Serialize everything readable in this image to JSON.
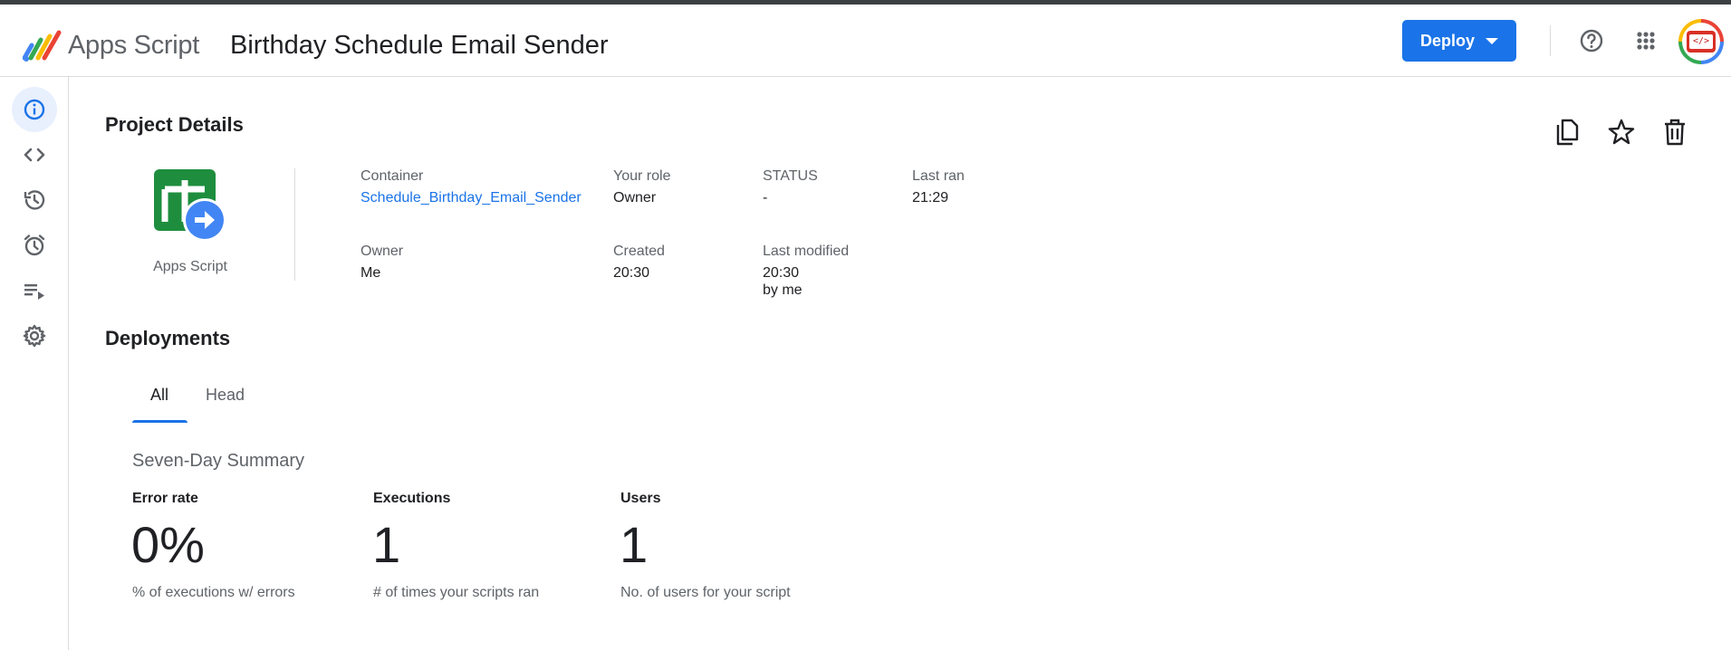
{
  "header": {
    "product_name": "Apps Script",
    "project_title": "Birthday Schedule Email Sender",
    "deploy_label": "Deploy",
    "avatar_text": "</>",
    "icons": [
      "apps-script-logo",
      "help-icon",
      "apps-grid-icon",
      "account-avatar"
    ]
  },
  "sidebar": {
    "items": [
      {
        "name": "overview",
        "icon": "info-icon",
        "active": true
      },
      {
        "name": "editor",
        "icon": "code-icon"
      },
      {
        "name": "triggers-history",
        "icon": "history-icon"
      },
      {
        "name": "triggers",
        "icon": "alarm-clock-icon"
      },
      {
        "name": "executions",
        "icon": "executions-list-icon"
      },
      {
        "name": "settings",
        "icon": "gear-icon"
      }
    ]
  },
  "project_details": {
    "title": "Project Details",
    "logo_label": "Apps Script",
    "fields": {
      "container_label": "Container",
      "container_value": "Schedule_Birthday_Email_Sender",
      "role_label": "Your role",
      "role_value": "Owner",
      "status_label": "STATUS",
      "status_value": "-",
      "last_ran_label": "Last ran",
      "last_ran_value": "21:29",
      "owner_label": "Owner",
      "owner_value": "Me",
      "created_label": "Created",
      "created_value": "20:30",
      "modified_label": "Last modified",
      "modified_value": "20:30",
      "modified_by": "by me"
    },
    "actions": [
      "copy-icon",
      "star-icon",
      "delete-icon"
    ]
  },
  "deployments": {
    "title": "Deployments",
    "tabs": [
      {
        "label": "All",
        "active": true
      },
      {
        "label": "Head",
        "active": false
      }
    ],
    "summary": {
      "title": "Seven-Day Summary",
      "stats": [
        {
          "label": "Error rate",
          "value": "0%",
          "desc": "% of executions w/ errors"
        },
        {
          "label": "Executions",
          "value": "1",
          "desc": "# of times your scripts ran"
        },
        {
          "label": "Users",
          "value": "1",
          "desc": "No. of users for your script"
        }
      ]
    }
  },
  "colors": {
    "accent": "#1a73e8",
    "logo_green": "#1e8e3e",
    "logo_blue": "#4285f4",
    "top_strip": "#3c4043"
  }
}
